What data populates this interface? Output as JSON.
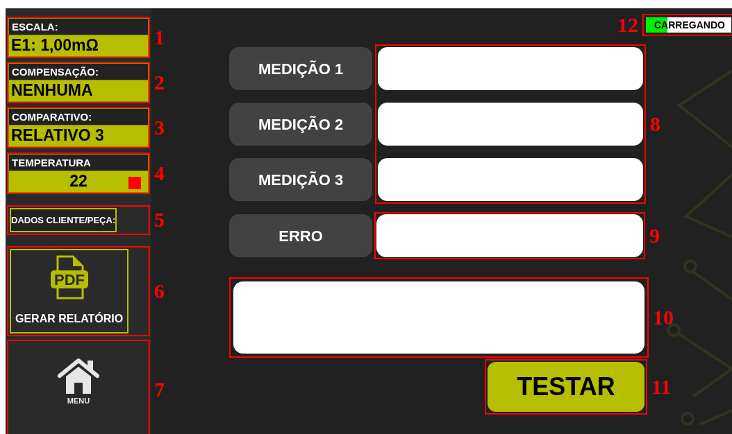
{
  "sidebar": {
    "items": [
      {
        "kind": "readout",
        "label": "ESCALA:",
        "value": "E1: 1,00mΩ",
        "callout": "1"
      },
      {
        "kind": "readout",
        "label": "COMPENSAÇÃO:",
        "value": "NENHUMA",
        "callout": "2"
      },
      {
        "kind": "readout",
        "label": "COMPARATIVO:",
        "value": "RELATIVO 3",
        "callout": "3"
      },
      {
        "kind": "temperature",
        "label": "TEMPERATURA",
        "value": "22",
        "color": "#ff0000",
        "callout": "4"
      },
      {
        "kind": "client",
        "label": "DADOS CLIENTE/PEÇA:",
        "callout": "5"
      },
      {
        "kind": "report",
        "icon_text": "PDF",
        "label": "GERAR RELATÓRIO",
        "callout": "6"
      },
      {
        "kind": "menu",
        "label": "MENU",
        "callout": "7"
      }
    ]
  },
  "status": {
    "label": "CARREGANDO",
    "level": 0.25,
    "callout": "12"
  },
  "measurements": {
    "callout": "8",
    "rows": [
      {
        "label": "MEDIÇÃO 1"
      },
      {
        "label": "MEDIÇÃO 2"
      },
      {
        "label": "MEDIÇÃO 3"
      }
    ]
  },
  "error": {
    "label": "ERRO",
    "callout": "9"
  },
  "result": {
    "callout": "10"
  },
  "test_button": {
    "label": "TESTAR",
    "callout": "11"
  }
}
